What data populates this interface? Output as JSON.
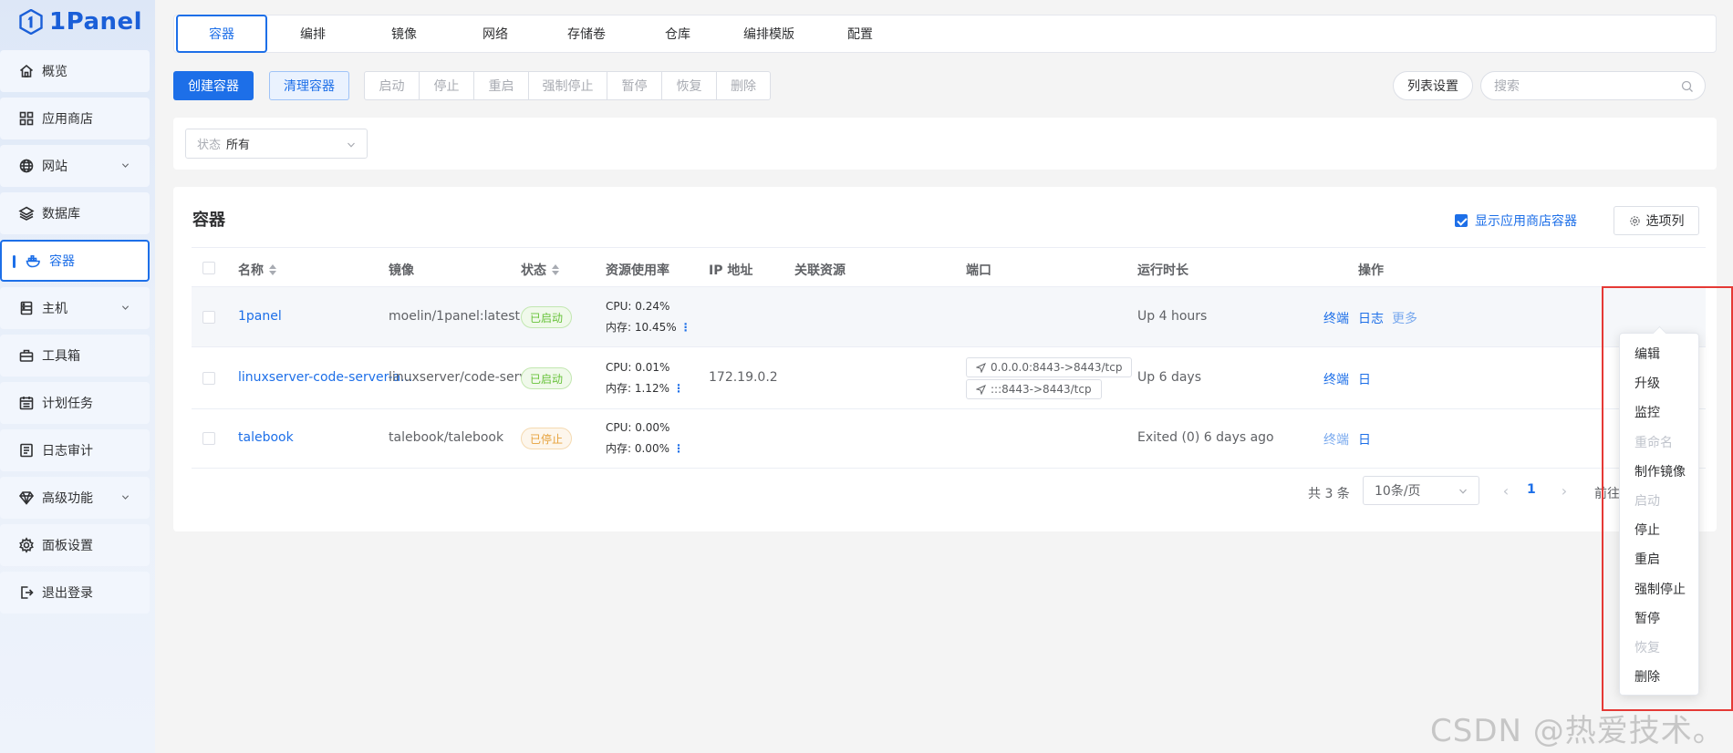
{
  "app": {
    "logo_text": "1Panel",
    "accent": "#1d6fe8"
  },
  "sidebar": {
    "items": [
      {
        "label": "概览",
        "icon": "home-icon",
        "expandable": false,
        "active": false
      },
      {
        "label": "应用商店",
        "icon": "apps-grid-icon",
        "expandable": false,
        "active": false
      },
      {
        "label": "网站",
        "icon": "globe-icon",
        "expandable": true,
        "active": false
      },
      {
        "label": "数据库",
        "icon": "layers-icon",
        "expandable": false,
        "active": false
      },
      {
        "label": "容器",
        "icon": "docker-icon",
        "expandable": false,
        "active": true
      },
      {
        "label": "主机",
        "icon": "server-icon",
        "expandable": true,
        "active": false
      },
      {
        "label": "工具箱",
        "icon": "toolbox-icon",
        "expandable": false,
        "active": false
      },
      {
        "label": "计划任务",
        "icon": "calendar-icon",
        "expandable": false,
        "active": false
      },
      {
        "label": "日志审计",
        "icon": "log-icon",
        "expandable": false,
        "active": false
      },
      {
        "label": "高级功能",
        "icon": "diamond-icon",
        "expandable": true,
        "active": false
      },
      {
        "label": "面板设置",
        "icon": "gear-icon",
        "expandable": false,
        "active": false
      },
      {
        "label": "退出登录",
        "icon": "logout-icon",
        "expandable": false,
        "active": false
      }
    ]
  },
  "tabs": [
    "容器",
    "编排",
    "镜像",
    "网络",
    "存储卷",
    "仓库",
    "编排模版",
    "配置"
  ],
  "toolbar": {
    "create": "创建容器",
    "clean": "清理容器",
    "group": [
      "启动",
      "停止",
      "重启",
      "强制停止",
      "暂停",
      "恢复",
      "删除"
    ],
    "list_settings": "列表设置",
    "search_placeholder": "搜索"
  },
  "filter": {
    "prefix": "状态",
    "value": "所有"
  },
  "card": {
    "title": "容器",
    "show_app_containers": "显示应用商店容器",
    "columns_button": "选项列"
  },
  "table": {
    "headers": {
      "name": "名称",
      "image": "镜像",
      "status": "状态",
      "resource": "资源使用率",
      "ip": "IP 地址",
      "related": "关联资源",
      "ports": "端口",
      "uptime": "运行时长",
      "actions": "操作"
    },
    "rows": [
      {
        "name": "1panel",
        "image": "moelin/1panel:latest",
        "status": "已启动",
        "status_kind": "run",
        "cpu": "CPU: 0.24%",
        "mem": "内存: 10.45%",
        "ip": "",
        "ports": [],
        "uptime": "Up 4 hours",
        "terminal": "终端",
        "log": "日志",
        "more": "更多"
      },
      {
        "name": "linuxserver-code-server-a...",
        "image": "linuxserver/code-serv...",
        "status": "已启动",
        "status_kind": "run",
        "cpu": "CPU: 0.01%",
        "mem": "内存: 1.12%",
        "ip": "172.19.0.2",
        "ports": [
          "0.0.0.0:8443->8443/tcp",
          ":::8443->8443/tcp"
        ],
        "uptime": "Up 6 days",
        "terminal": "终端",
        "log": "日"
      },
      {
        "name": "talebook",
        "image": "talebook/talebook",
        "status": "已停止",
        "status_kind": "stop",
        "cpu": "CPU: 0.00%",
        "mem": "内存: 0.00%",
        "ip": "",
        "ports": [],
        "uptime": "Exited (0) 6 days ago",
        "terminal": "终端",
        "log": "日"
      }
    ]
  },
  "pagination": {
    "total": "共 3 条",
    "page_size": "10条/页",
    "current": "1",
    "goto": "前往"
  },
  "more_menu": {
    "items": [
      {
        "label": "编辑",
        "disabled": false
      },
      {
        "label": "升级",
        "disabled": false
      },
      {
        "label": "监控",
        "disabled": false
      },
      {
        "label": "重命名",
        "disabled": true
      },
      {
        "label": "制作镜像",
        "disabled": false
      },
      {
        "label": "启动",
        "disabled": true
      },
      {
        "label": "停止",
        "disabled": false
      },
      {
        "label": "重启",
        "disabled": false
      },
      {
        "label": "强制停止",
        "disabled": false
      },
      {
        "label": "暂停",
        "disabled": false
      },
      {
        "label": "恢复",
        "disabled": true
      },
      {
        "label": "删除",
        "disabled": false
      }
    ]
  },
  "watermark": "CSDN @热爱技术。"
}
